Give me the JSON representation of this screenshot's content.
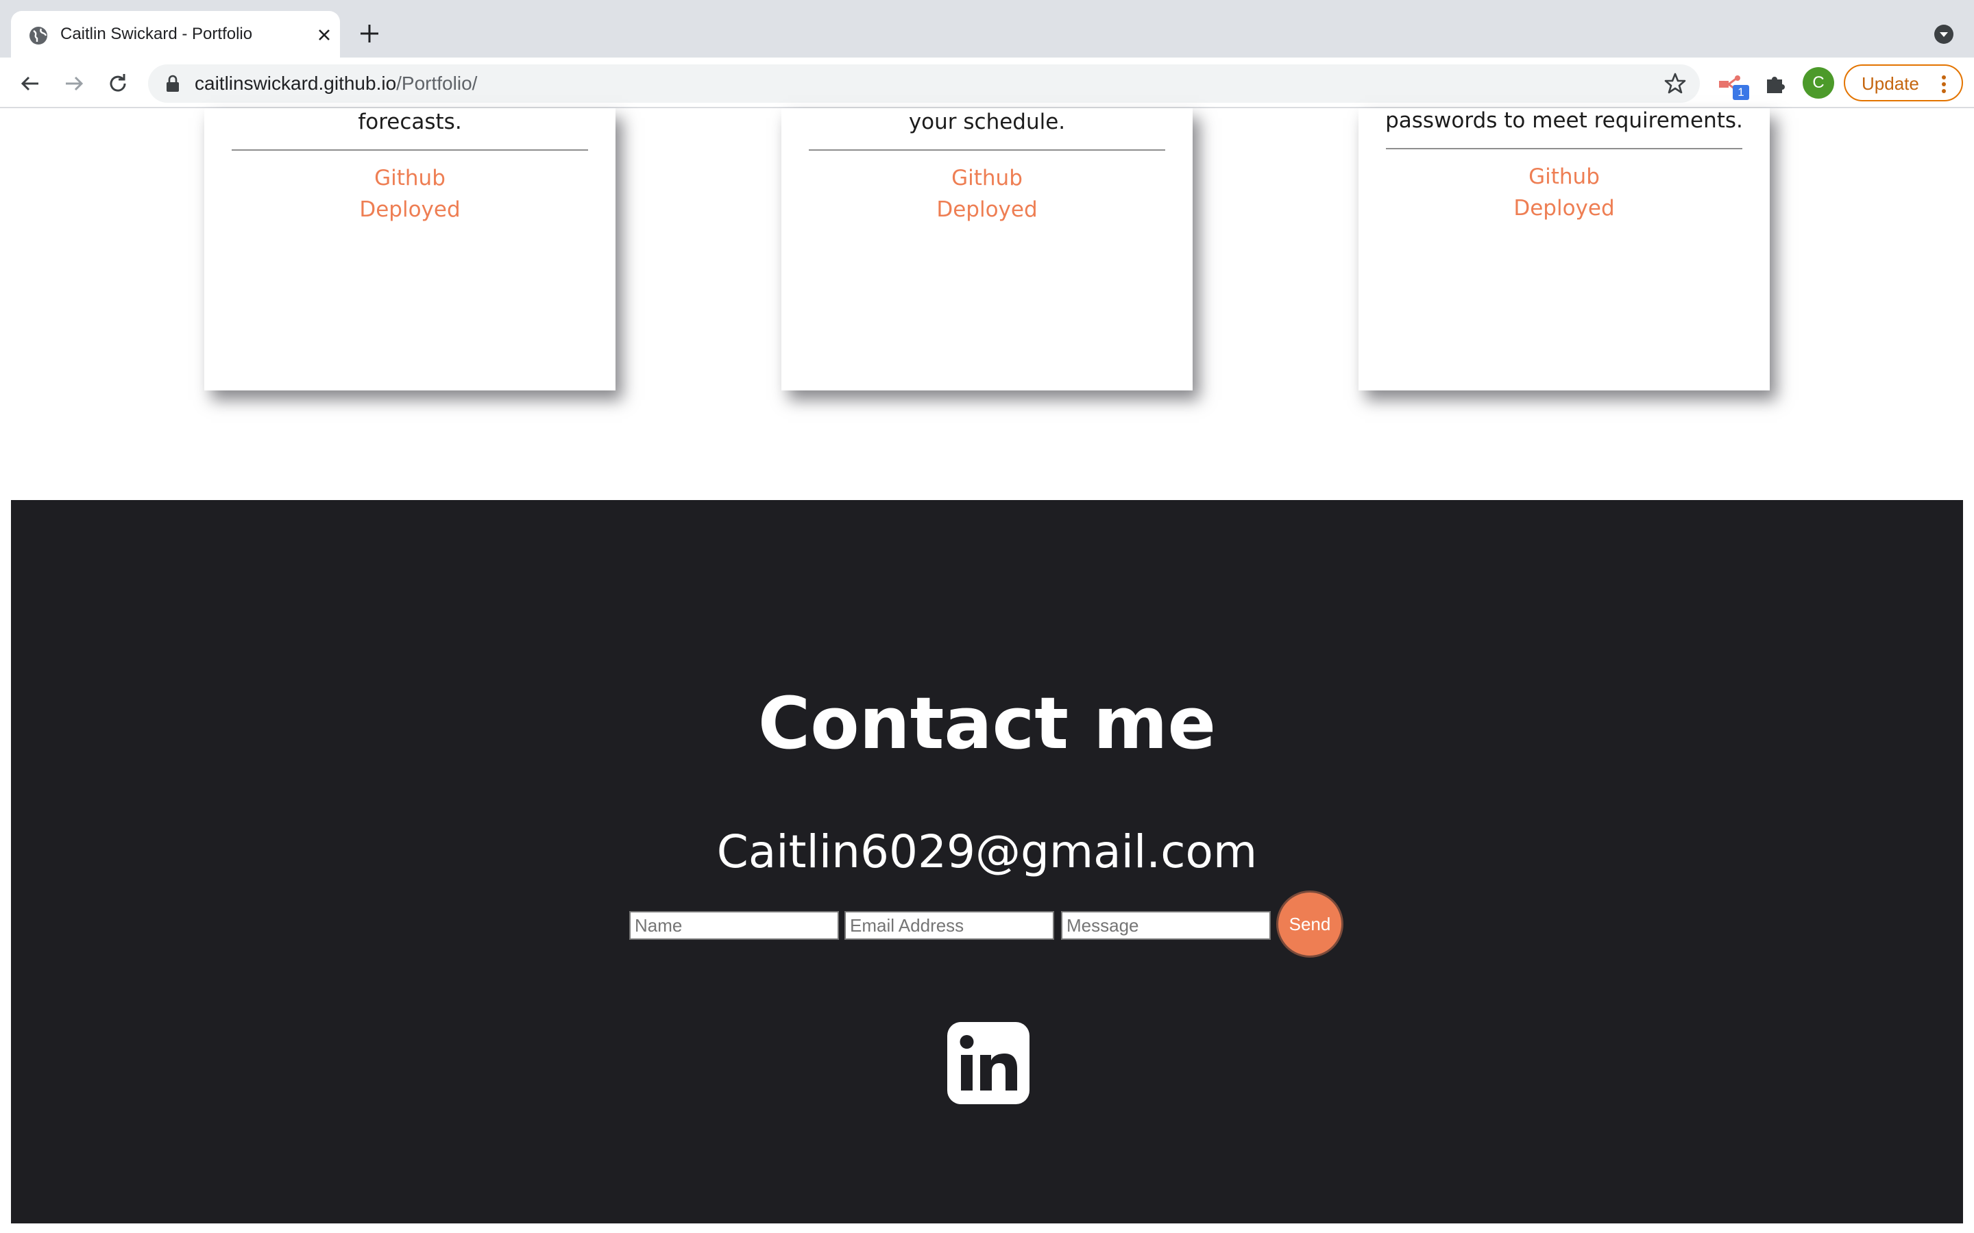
{
  "browser": {
    "tab_title": "Caitlin Swickard - Portfolio",
    "url_host": "caitlinswickard.github.io",
    "url_path": "/Portfolio/",
    "extension_badge": "1",
    "profile_initial": "C",
    "update_label": "Update",
    "icons": [
      "globe-icon",
      "close-icon",
      "plus-icon",
      "back-icon",
      "forward-icon",
      "reload-icon",
      "lock-icon",
      "star-icon",
      "extension-icon",
      "puzzle-icon",
      "kebab-menu-icon",
      "tab-search-icon"
    ]
  },
  "projects": [
    {
      "description": "forecasts.",
      "github_label": "Github",
      "deployed_label": "Deployed"
    },
    {
      "description": "your schedule.",
      "github_label": "Github",
      "deployed_label": "Deployed"
    },
    {
      "description": "passwords to meet requirements.",
      "github_label": "Github",
      "deployed_label": "Deployed"
    }
  ],
  "contact": {
    "title": "Contact me",
    "email": "Caitlin6029@gmail.com",
    "name_placeholder": "Name",
    "email_placeholder": "Email Address",
    "message_placeholder": "Message",
    "send_label": "Send",
    "social_icon": "linkedin-icon"
  },
  "colors": {
    "accent": "#ee7e53",
    "footer_bg": "#1e1e22",
    "update_orange": "#e37400"
  }
}
